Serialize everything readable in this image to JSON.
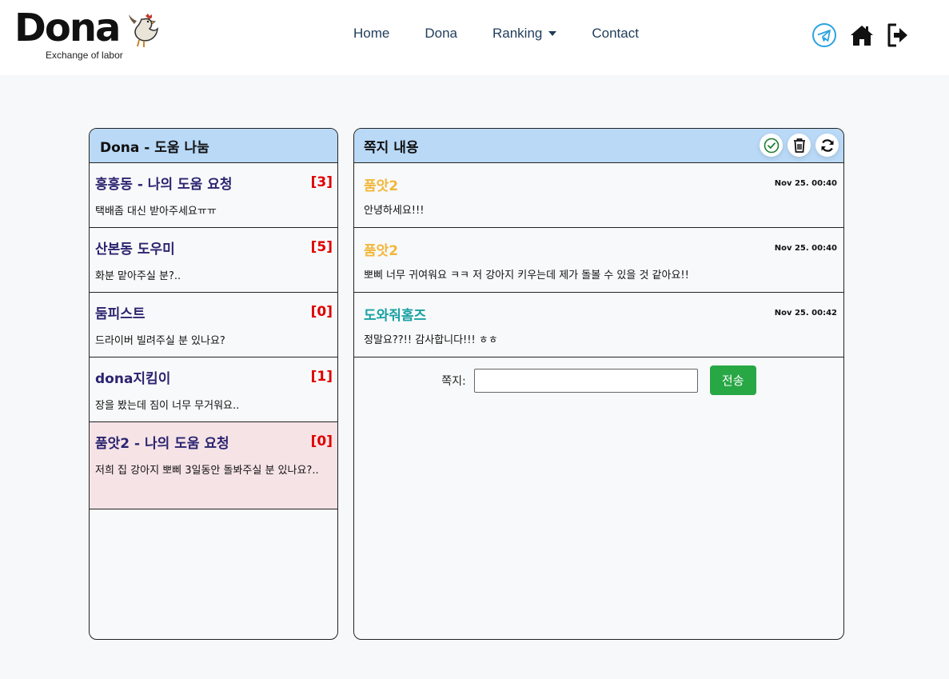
{
  "header": {
    "logo_text": "Dona",
    "logo_tagline": "Exchange of labor",
    "nav": [
      "Home",
      "Dona",
      "Ranking",
      "Contact"
    ]
  },
  "left_panel": {
    "title": "Dona - 도움 나눔",
    "threads": [
      {
        "title": "흥흥동 - 나의 도움 요청",
        "count": "[3]",
        "preview": "택배좀 대신 받아주세요ㅠㅠ"
      },
      {
        "title": "산본동 도우미",
        "count": "[5]",
        "preview": "화분 맡아주실 분?.."
      },
      {
        "title": "둠피스트",
        "count": "[0]",
        "preview": "드라이버 빌려주실 분 있나요?"
      },
      {
        "title": "dona지킴이",
        "count": "[1]",
        "preview": "장을 봤는데 짐이 너무 무거워요.."
      },
      {
        "title": "품앗2 - 나의 도움 요청",
        "count": "[0]",
        "preview": "저희 집 강아지 뽀삐 3일동안 돌봐주실 분 있나요?.."
      }
    ]
  },
  "right_panel": {
    "title": "쪽지 내용",
    "messages": [
      {
        "sender": "품앗2",
        "time": "Nov 25. 00:40",
        "text": "안녕하세요!!!"
      },
      {
        "sender": "품앗2",
        "time": "Nov 25. 00:40",
        "text": "뽀삐 너무 귀여워요 ㅋㅋ 저 강아지 키우는데 제가 돌볼 수 있을 것 같아요!!"
      },
      {
        "sender": "도와줘홈즈",
        "time": "Nov 25. 00:42",
        "text": "정말요??!! 감사합니다!!! ㅎㅎ"
      }
    ],
    "compose_label": "쪽지:",
    "send_label": "전송"
  },
  "colors": {
    "panel_header": "#b9d9f7",
    "thread_title": "#2a2470",
    "count_red": "#e00000",
    "active_thread_bg": "#f6e3e6",
    "sender_me": "#f2b63a",
    "sender_other": "#1aa1a4",
    "send_button": "#28a745"
  },
  "icons": [
    "rooster-icon",
    "caret-down-icon",
    "telegram-icon",
    "home-icon",
    "sign-out-icon",
    "check-circle-icon",
    "trash-icon",
    "refresh-icon"
  ]
}
